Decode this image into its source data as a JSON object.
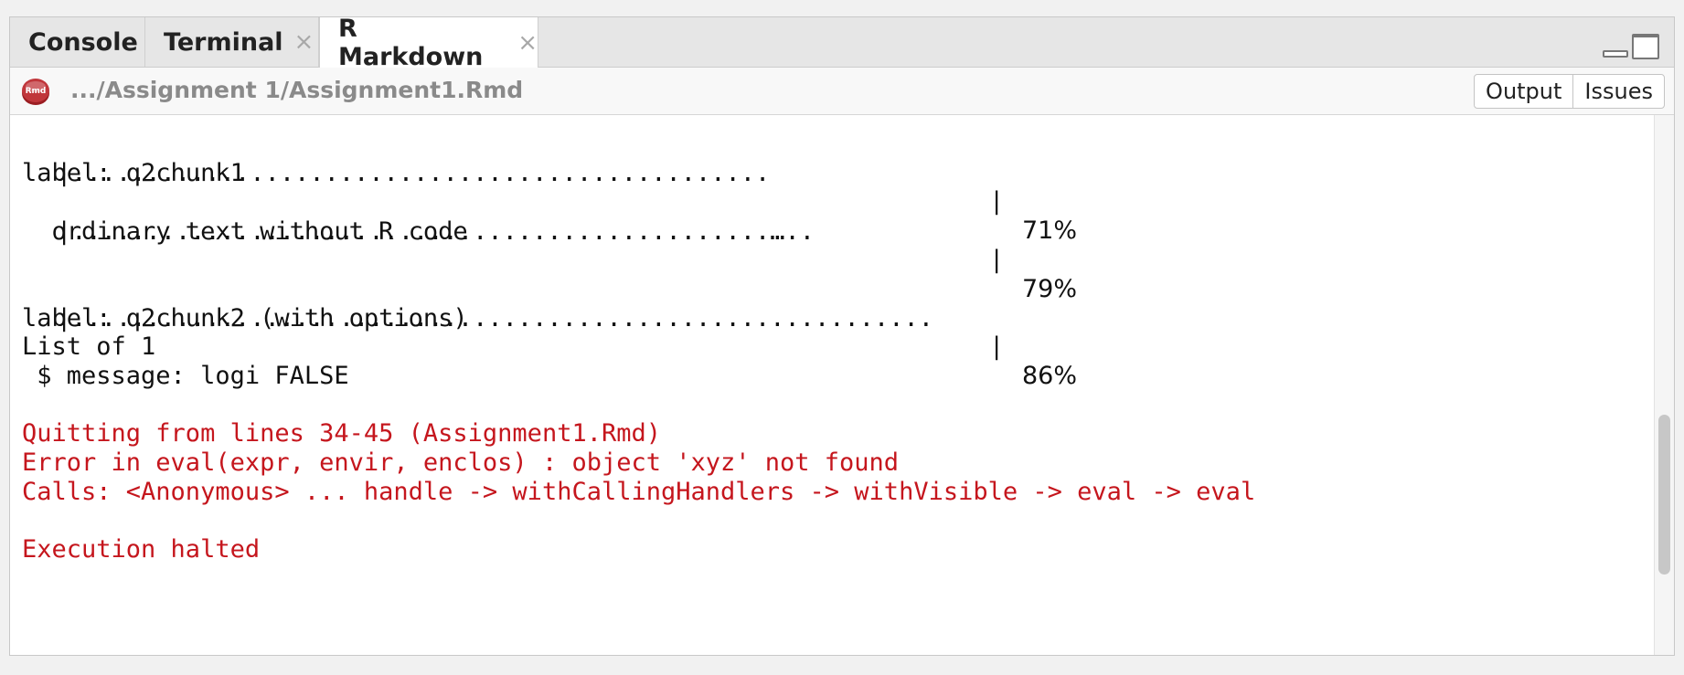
{
  "tabs": [
    {
      "label": "Console",
      "closable": false
    },
    {
      "label": "Terminal",
      "closable": true
    },
    {
      "label": "R Markdown",
      "closable": true,
      "active": true
    }
  ],
  "close_glyph": "×",
  "toolbar": {
    "file_icon": "rmd-file-icon",
    "file_icon_text": "Rmd",
    "file_path": ".../Assignment 1/Assignment1.Rmd",
    "buttons": [
      "Output",
      "Issues"
    ]
  },
  "progress_lines": [
    {
      "dots": "|...............................................",
      "pipe": "|",
      "percent": "71%"
    },
    {
      "dots": "|...............................................…..",
      "pipe": "|",
      "percent": "79%"
    },
    {
      "dots": "|..........................................................",
      "pipe": "|",
      "percent": "86%"
    }
  ],
  "output": {
    "label1": "label: q2chunk1",
    "ordinary": "  ordinary text without R code",
    "label2": "label: q2chunk2 (with options)",
    "list": "List of 1",
    "message": " $ message: logi FALSE",
    "error1": "Quitting from lines 34-45 (Assignment1.Rmd)",
    "error2": "Error in eval(expr, envir, enclos) : object 'xyz' not found",
    "error3": "Calls: <Anonymous> ... handle -> withCallingHandlers -> withVisible -> eval -> eval",
    "error4": "Execution halted"
  },
  "colors": {
    "error": "#c5161d",
    "rmd_icon": "#b3262b"
  }
}
